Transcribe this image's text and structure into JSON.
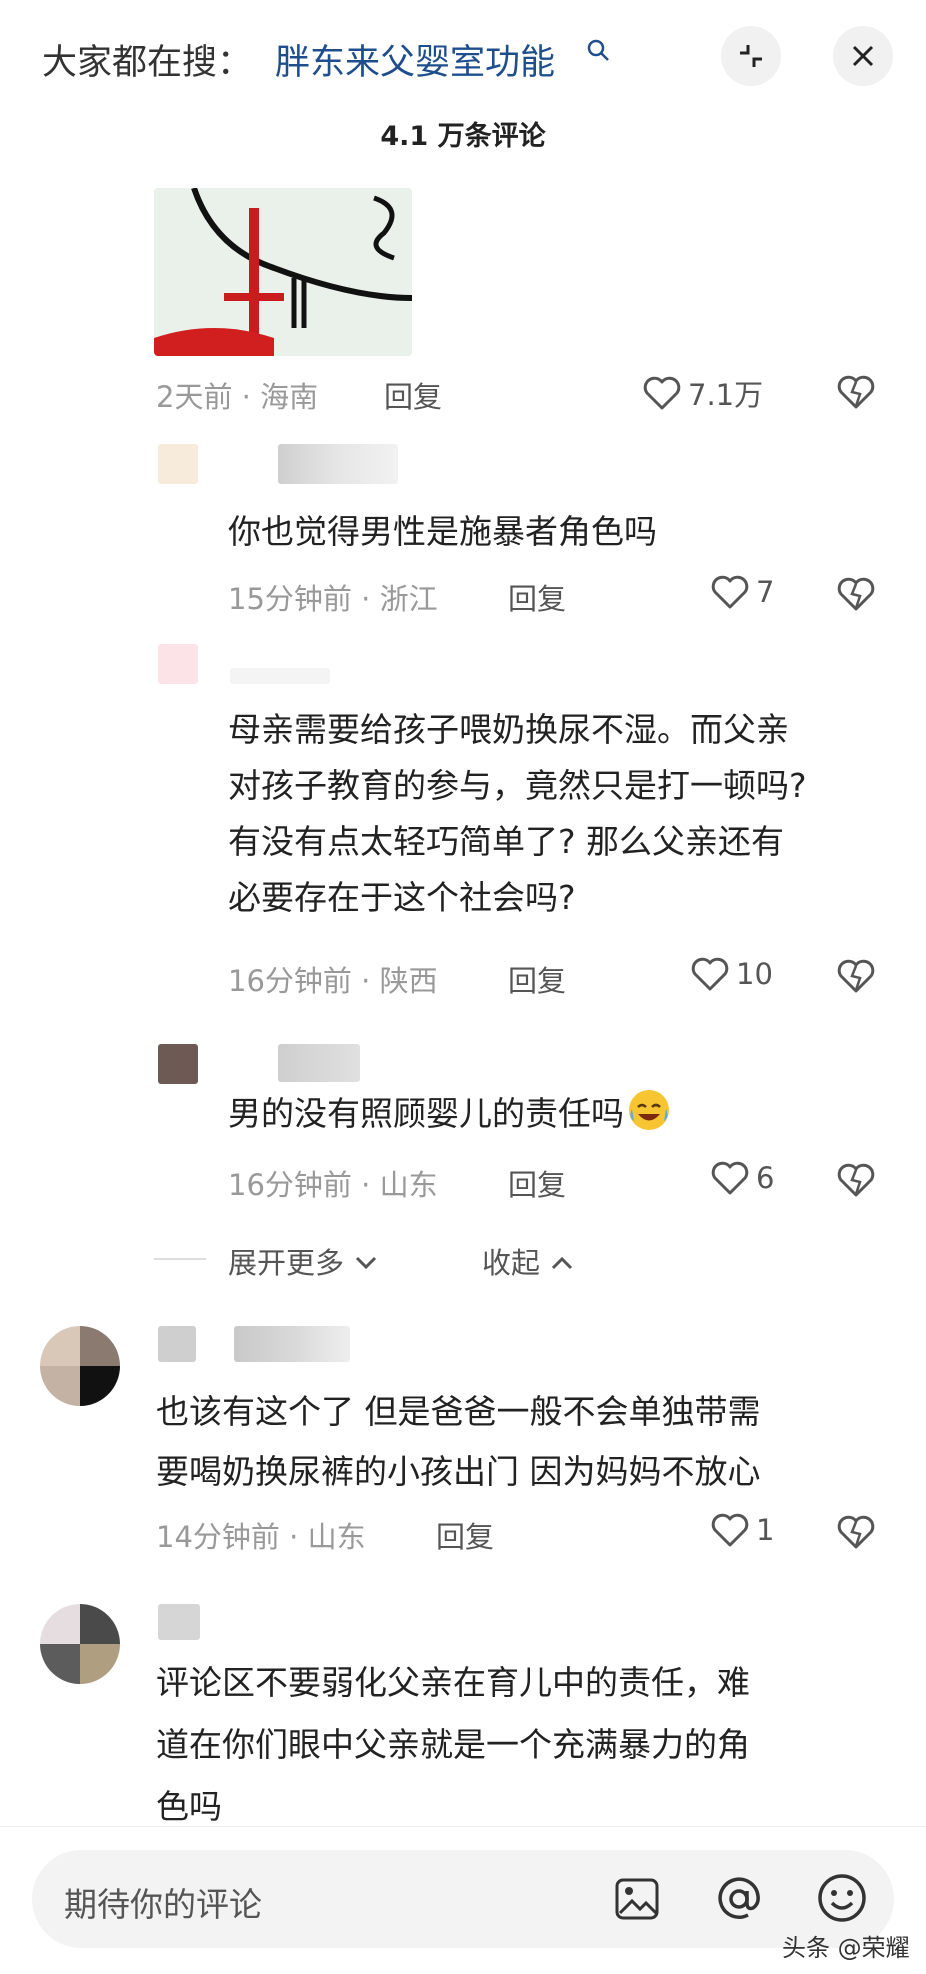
{
  "header": {
    "search_prefix": "大家都在搜：",
    "search_term": "胖东来父婴室功能",
    "comment_count": "4.1 万条评论"
  },
  "comments": [
    {
      "time": "2天前",
      "sep": "·",
      "region": "海南",
      "reply": "回复",
      "likes": "7.1万"
    },
    {
      "text": "你也觉得男性是施暴者角色吗",
      "time": "15分钟前",
      "sep": "·",
      "region": "浙江",
      "reply": "回复",
      "likes": "7"
    },
    {
      "text_lines": [
        "母亲需要给孩子喂奶换尿不湿。而父亲",
        "对孩子教育的参与，竟然只是打一顿吗?",
        "有没有点太轻巧简单了? 那么父亲还有",
        "必要存在于这个社会吗?"
      ],
      "time": "16分钟前",
      "sep": "·",
      "region": "陕西",
      "reply": "回复",
      "likes": "10"
    },
    {
      "text": "男的没有照顾婴儿的责任吗",
      "time": "16分钟前",
      "sep": "·",
      "region": "山东",
      "reply": "回复",
      "likes": "6"
    },
    {
      "text_lines": [
        "也该有这个了  但是爸爸一般不会单独带需",
        "要喝奶换尿裤的小孩出门  因为妈妈不放心"
      ],
      "time": "14分钟前",
      "sep": "·",
      "region": "山东",
      "reply": "回复",
      "likes": "1"
    },
    {
      "text_lines": [
        "评论区不要弱化父亲在育儿中的责任，难",
        "道在你们眼中父亲就是一个充满暴力的角",
        "色吗"
      ]
    }
  ],
  "thread": {
    "expand_more": "展开更多",
    "collapse": "收起"
  },
  "footer": {
    "placeholder": "期待你的评论"
  },
  "watermark": "头条 @荣耀",
  "colors": {
    "link": "#1f4e8c",
    "meta": "#999999",
    "background": "#ffffff"
  }
}
